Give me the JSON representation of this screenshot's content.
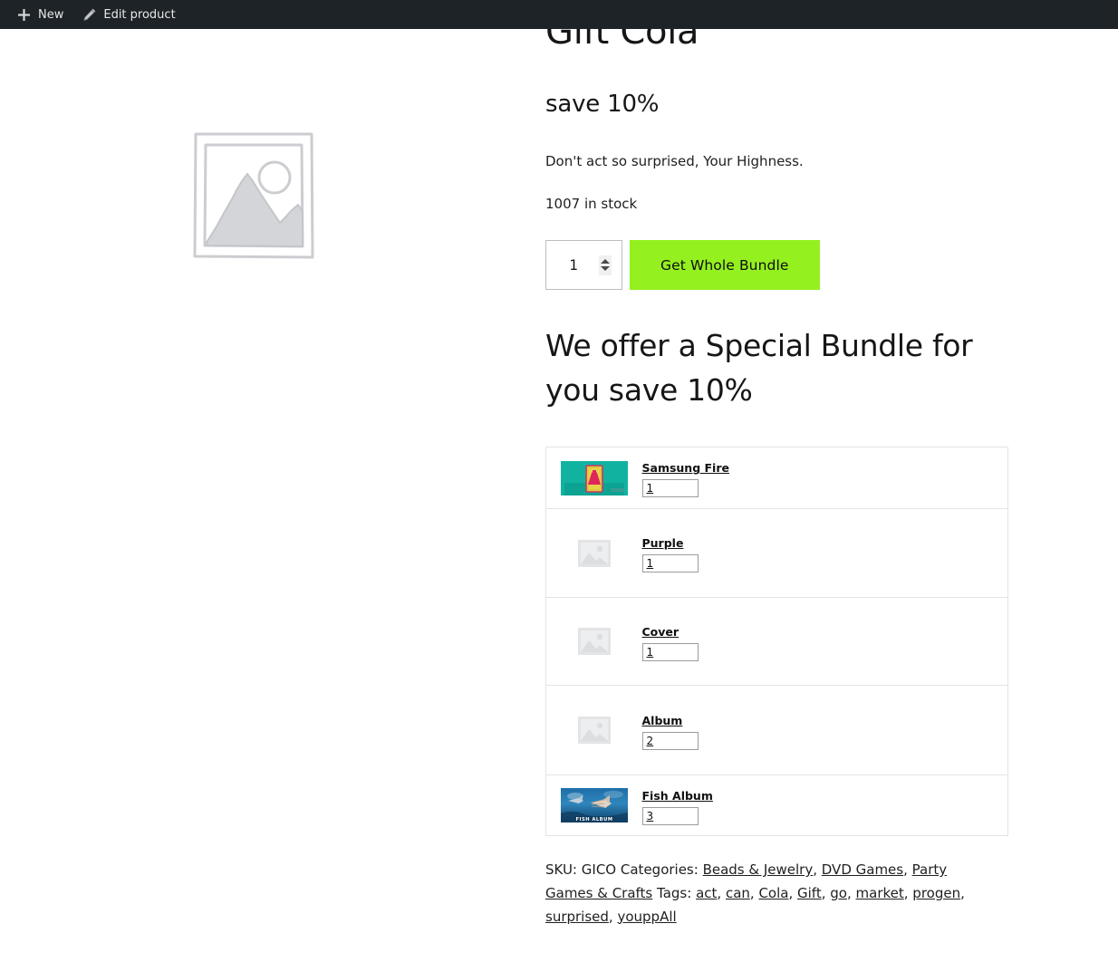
{
  "adminbar": {
    "items": [
      {
        "icon": "plus-icon",
        "label": "New"
      },
      {
        "icon": "pencil-icon",
        "label": "Edit product"
      }
    ]
  },
  "product": {
    "title": "Gift Cola",
    "price_label": "save 10%",
    "short_description": "Don't act so surprised, Your Highness.",
    "stock": "1007 in stock",
    "quantity": "1",
    "quantity_placeholder": "1",
    "add_to_cart_label": "Get Whole Bundle",
    "add_to_cart_color": "#94f01f",
    "placeholder_image": "product-placeholder-image"
  },
  "bundle": {
    "heading": "We offer a Special Bundle for you save 10%",
    "items": [
      {
        "name": "Samsung Fire",
        "qty": "1",
        "thumb": "samsung-fire-thumbnail"
      },
      {
        "name": "Purple",
        "qty": "1",
        "thumb": "placeholder-thumbnail"
      },
      {
        "name": "Cover",
        "qty": "1",
        "thumb": "placeholder-thumbnail"
      },
      {
        "name": "Album",
        "qty": "2",
        "thumb": "placeholder-thumbnail"
      },
      {
        "name": "Fish Album",
        "qty": "3",
        "thumb": "fish-album-thumbnail"
      }
    ]
  },
  "meta": {
    "sku_label": "SKU:",
    "sku_value": "GICO",
    "categories_label": "Categories:",
    "categories": [
      "Beads & Jewelry",
      "DVD Games",
      "Party Games & Crafts"
    ],
    "tags_label": "Tags:",
    "tags": [
      "act",
      "can",
      "Cola",
      "Gift",
      "go",
      "market",
      "progen",
      "surprised",
      "youppAll"
    ]
  }
}
